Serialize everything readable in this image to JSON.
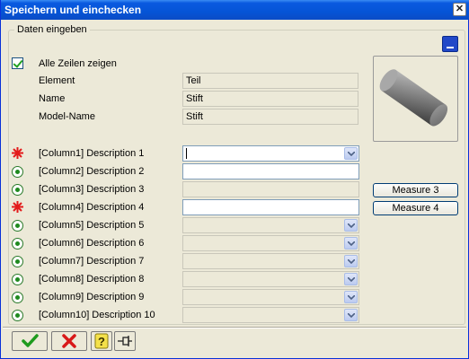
{
  "window": {
    "title": "Speichern und einchecken"
  },
  "group": {
    "legend": "Daten eingeben"
  },
  "show_all_rows": {
    "label": "Alle Zeilen zeigen",
    "checked": true
  },
  "info_fields": [
    {
      "label": "Element",
      "value": "Teil"
    },
    {
      "label": "Name",
      "value": "Stift"
    },
    {
      "label": "Model-Name",
      "value": "Stift"
    }
  ],
  "rows": [
    {
      "label": "[Column1] Description 1",
      "marker": "required-star",
      "control": "combo",
      "active": true,
      "value": ""
    },
    {
      "label": "[Column2] Description 2",
      "marker": "optional-dot",
      "control": "text",
      "value": ""
    },
    {
      "label": "[Column3] Description 3",
      "marker": "optional-dot",
      "control": "text-disabled",
      "value": ""
    },
    {
      "label": "[Column4] Description 4",
      "marker": "required-star",
      "control": "text",
      "value": ""
    },
    {
      "label": "[Column5] Description 5",
      "marker": "optional-dot",
      "control": "combo",
      "value": ""
    },
    {
      "label": "[Column6] Description 6",
      "marker": "optional-dot",
      "control": "combo",
      "value": ""
    },
    {
      "label": "[Column7] Description 7",
      "marker": "optional-dot",
      "control": "combo",
      "value": ""
    },
    {
      "label": "[Column8] Description 8",
      "marker": "optional-dot",
      "control": "combo",
      "value": ""
    },
    {
      "label": "[Column9] Description 9",
      "marker": "optional-dot",
      "control": "combo",
      "value": ""
    },
    {
      "label": "[Column10] Description 10",
      "marker": "optional-dot",
      "control": "combo",
      "value": ""
    }
  ],
  "measure_buttons": {
    "measure3": "Measure 3",
    "measure4": "Measure 4"
  },
  "toolbar": {
    "ok_icon": "green-check-icon",
    "cancel_icon": "red-x-icon",
    "help_icon": "help-icon",
    "pin_icon": "pin-icon"
  },
  "colors": {
    "required": "#e31b1b",
    "optional": "#1f8a1f",
    "title": "#0554d6"
  }
}
